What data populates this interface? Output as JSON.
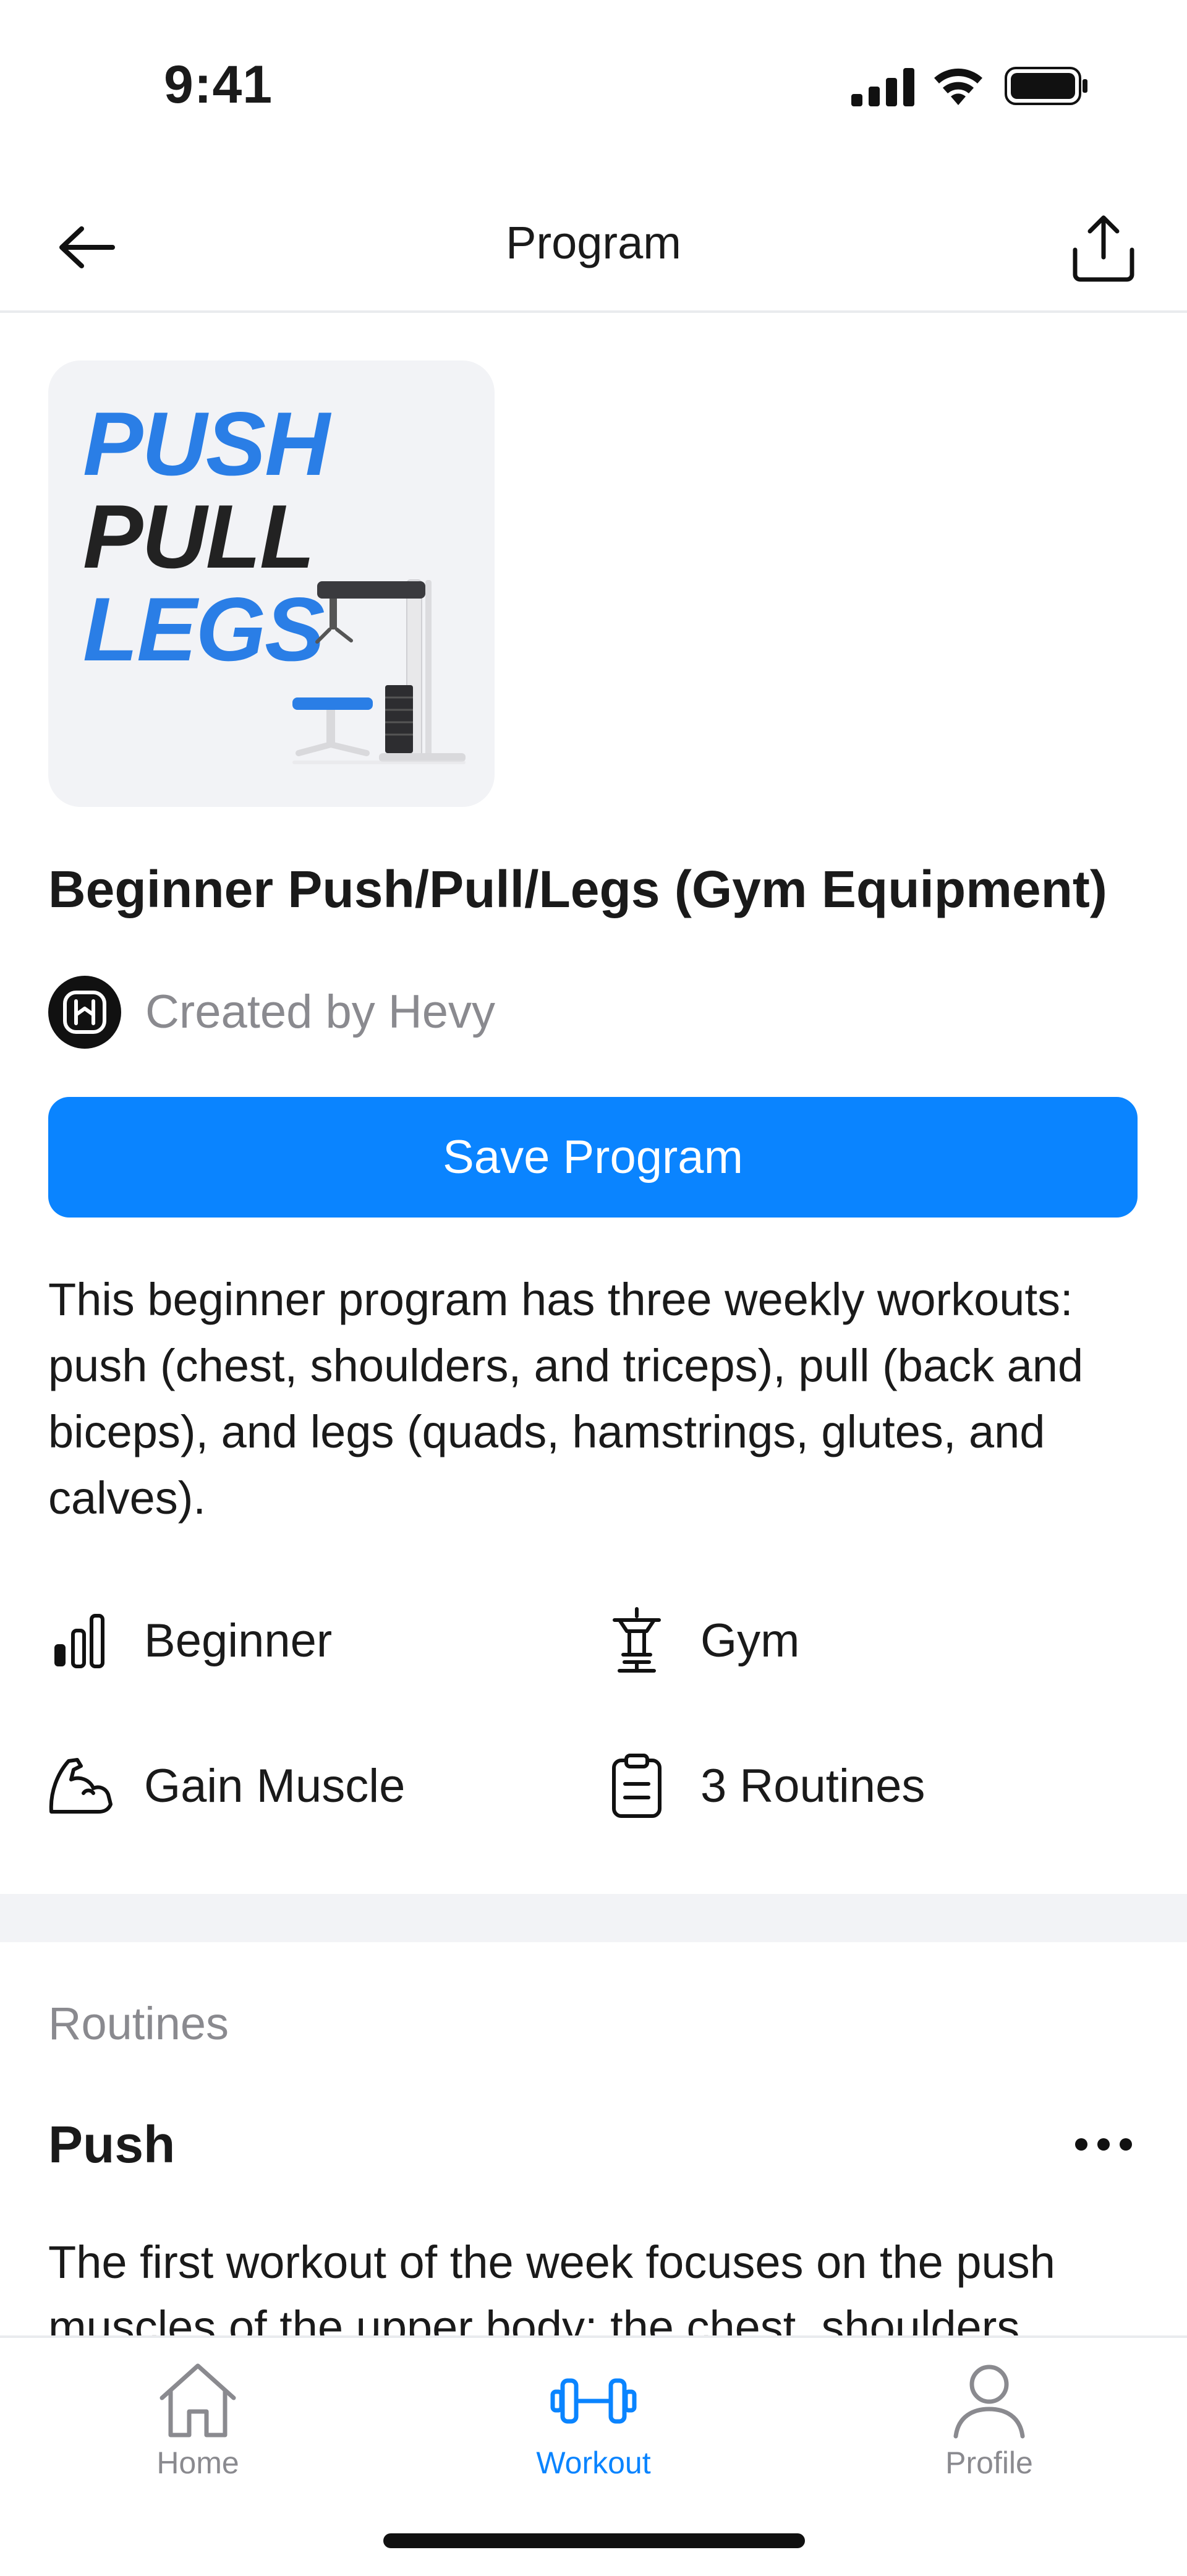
{
  "status_bar": {
    "time": "9:41"
  },
  "nav": {
    "title": "Program"
  },
  "cover": {
    "lines": [
      "PUSH",
      "PULL",
      "LEGS"
    ]
  },
  "program": {
    "title": "Beginner Push/Pull/Legs (Gym Equipment)",
    "creator": "Created by Hevy",
    "save_label": "Save Program",
    "description": "This beginner program has three weekly workouts: push (chest, shoulders, and triceps), pull (back and biceps), and legs (quads, hamstrings, glutes, and calves).",
    "meta": {
      "level": "Beginner",
      "equipment": "Gym",
      "goal": "Gain Muscle",
      "routines_count": "3 Routines"
    }
  },
  "routines": {
    "heading": "Routines",
    "items": [
      {
        "name": "Push",
        "description": "The first workout of the week focuses on the push muscles of the upper body: the chest, shoulders"
      }
    ]
  },
  "tabbar": {
    "items": [
      {
        "label": "Home",
        "icon": "home-icon"
      },
      {
        "label": "Workout",
        "icon": "dumbbell-icon"
      },
      {
        "label": "Profile",
        "icon": "person-icon"
      }
    ],
    "active": "Workout"
  },
  "colors": {
    "accent": "#0a84ff",
    "cover_blue": "#2a7ee6",
    "muted": "#8a8a8f"
  }
}
